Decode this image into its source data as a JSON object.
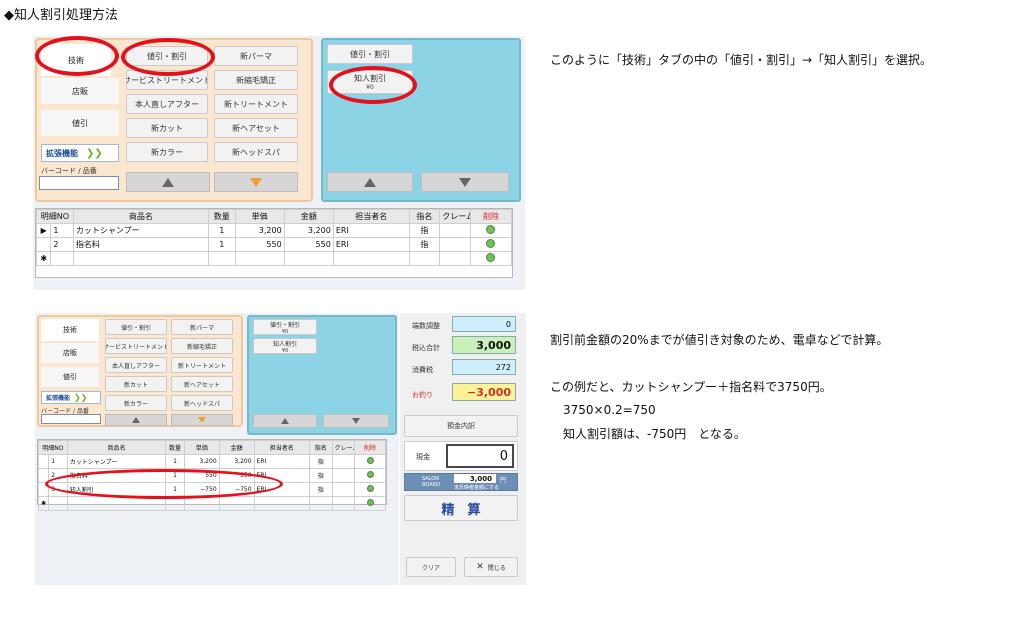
{
  "heading": "◆知人割引処理方法",
  "shot1": {
    "tabs": [
      "技術",
      "店販",
      "値引"
    ],
    "ext_label": "拡張機能",
    "barcode_label": "バーコード / 品番",
    "buttons": [
      "値引・割引",
      "新パーマ",
      "サービストリートメント",
      "新縮毛矯正",
      "本人直しアフター",
      "新トリートメント",
      "新カット",
      "新ヘアセット",
      "新カラー",
      "新ヘッドスパ"
    ],
    "right_buttons": {
      "b1": "値引・割引",
      "b2": "知人割引",
      "b2_sub": "¥0"
    },
    "headers": [
      "明細NO",
      "商品名",
      "数量",
      "単価",
      "金額",
      "担当者名",
      "指名",
      "クレーム",
      "削除"
    ],
    "rows": [
      {
        "marker": "▶",
        "no": "1",
        "name": "カットシャンプー",
        "qty": "1",
        "price": "3,200",
        "amount": "3,200",
        "staff": "ERI",
        "nom": "指"
      },
      {
        "marker": "",
        "no": "2",
        "name": "指名料",
        "qty": "1",
        "price": "550",
        "amount": "550",
        "staff": "ERI",
        "nom": "指"
      },
      {
        "marker": "✱",
        "no": "",
        "name": "",
        "qty": "",
        "price": "",
        "amount": "",
        "staff": "",
        "nom": ""
      }
    ]
  },
  "shot2": {
    "tabs": [
      "技術",
      "店販",
      "値引"
    ],
    "ext_label": "拡張機能",
    "barcode_label": "バーコード / 品番",
    "buttons": [
      "値引・割引",
      "新パーマ",
      "サービストリートメント",
      "新縮毛矯正",
      "本人直しアフター",
      "新トリートメント",
      "新カット",
      "新ヘアセット",
      "新カラー",
      "新ヘッドスパ"
    ],
    "right_buttons": {
      "b1": "値引・割引",
      "b1_sub": "¥0",
      "b2": "知人割引",
      "b2_sub": "¥0"
    },
    "headers": [
      "明細NO",
      "商品名",
      "数量",
      "単価",
      "金額",
      "担当者名",
      "指名",
      "クレーム",
      "削除"
    ],
    "rows": [
      {
        "marker": "",
        "no": "1",
        "name": "カットシャンプー",
        "qty": "1",
        "price": "3,200",
        "amount": "3,200",
        "staff": "ERI",
        "nom": "指"
      },
      {
        "marker": "",
        "no": "2",
        "name": "指名料",
        "qty": "1",
        "price": "550",
        "amount": "550",
        "staff": "ERI",
        "nom": "指"
      },
      {
        "marker": "",
        "no": "3",
        "name": "知人割引",
        "qty": "1",
        "price": "−750",
        "amount": "−750",
        "staff": "ERI",
        "nom": "指"
      },
      {
        "marker": "✱",
        "no": "",
        "name": "",
        "qty": "",
        "price": "",
        "amount": "",
        "staff": "",
        "nom": ""
      }
    ],
    "side": {
      "adjust_label": "端数調整",
      "adjust_val": "0",
      "total_label": "税込合計",
      "total_val": "3,000",
      "tax_label": "消費税",
      "tax_val": "272",
      "change_label": "お釣り",
      "change_val": "−3,000",
      "breakdown_btn": "預金内訳",
      "cash_label": "現金",
      "cash_val": "0",
      "salon_label": "SALON BOARD",
      "salon_val": "3,000",
      "salon_unit": "円",
      "salon_note": "未反映者金額にする",
      "settle_btn": "精　算",
      "clear_btn": "クリア",
      "close_btn": "閉じる"
    }
  },
  "para1": "このように「技術」タブの中の「値引・割引」→「知人割引」を選択。",
  "para2": "割引前金額の20%までが値引き対象のため、電卓などで計算。",
  "para3": "この例だと、カットシャンプー＋指名料で3750円。",
  "para4": "3750×0.2=750",
  "para5": "知人割引額は、-750円　となる。"
}
